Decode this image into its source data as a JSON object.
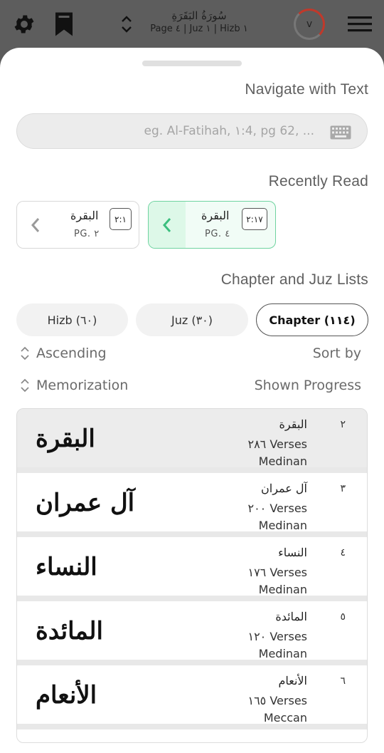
{
  "topbar": {
    "surah_title": "سُورَةُ البَقَرَةِ",
    "location": "Page ٤ | Juz ١ | Hizb ١",
    "ring_label": "v"
  },
  "sheet": {
    "navigate_title": "Navigate with Text",
    "search_placeholder": "eg. Al-Fatihah, ١:4, pg 62, ...",
    "recent_title": "Recently Read",
    "recent": [
      {
        "name": "البقرة",
        "page": "PG. ٤",
        "verse": "٢:١٧"
      },
      {
        "name": "البقرة",
        "page": "PG. ٢",
        "verse": "٢:١"
      }
    ],
    "lists_title": "Chapter and Juz Lists",
    "tabs": {
      "hizb": "Hizb (٦٠)",
      "juz": "Juz (٣٠)",
      "chapter": "Chapter (١١٤)"
    },
    "sort": {
      "order": "Ascending",
      "sort_by": "Sort by",
      "mode": "Memorization",
      "shown": "Shown Progress"
    },
    "chapters": [
      {
        "num": "٢",
        "name": "البقرة",
        "verses": "٢٨٦ Verses",
        "revelation": "Medinan",
        "calligraphy": "البقرة"
      },
      {
        "num": "٣",
        "name": "آل عمران",
        "verses": "٢٠٠ Verses",
        "revelation": "Medinan",
        "calligraphy": "آل عمران"
      },
      {
        "num": "٤",
        "name": "النساء",
        "verses": "١٧٦ Verses",
        "revelation": "Medinan",
        "calligraphy": "النساء"
      },
      {
        "num": "٥",
        "name": "المائدة",
        "verses": "١٢٠ Verses",
        "revelation": "Medinan",
        "calligraphy": "المائدة"
      },
      {
        "num": "٦",
        "name": "الأنعام",
        "verses": "١٦٥ Verses",
        "revelation": "Meccan",
        "calligraphy": "الأنعام"
      }
    ]
  },
  "colors": {
    "accent_green": "#6fd3a0",
    "ring_red": "#c0392b"
  },
  "icons": [
    "gear-icon",
    "bookmark-icon",
    "chevron-updown-icon",
    "progress-ring",
    "menu-icon",
    "keyboard-icon",
    "chevron-left-icon",
    "sort-icon"
  ]
}
